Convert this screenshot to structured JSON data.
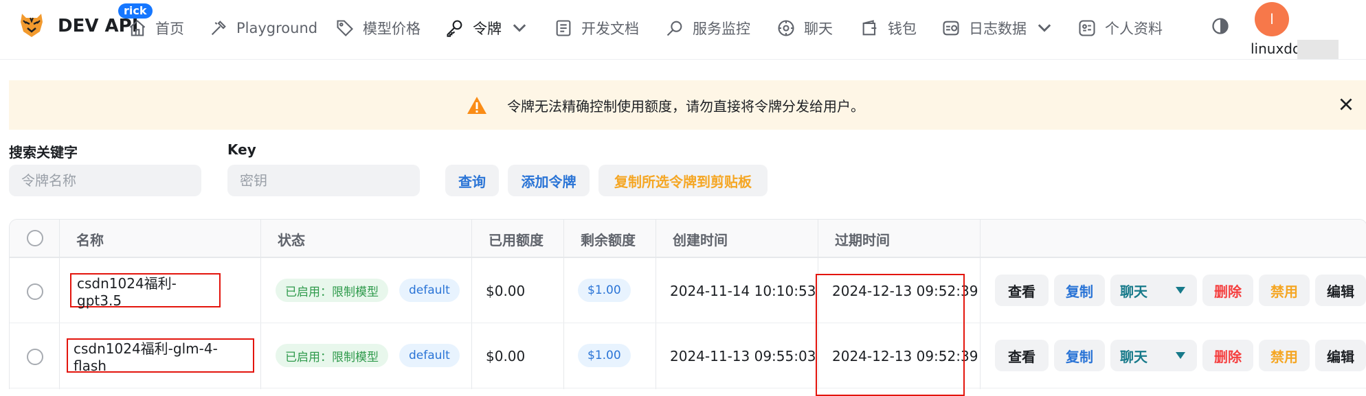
{
  "header": {
    "brand": "DEV API",
    "badge": "rick",
    "nav": [
      {
        "label": "首页",
        "icon": "home-icon"
      },
      {
        "label": "Playground",
        "icon": "playground-icon"
      },
      {
        "label": "模型价格",
        "icon": "tag-icon"
      },
      {
        "label": "令牌",
        "icon": "key-icon"
      },
      {
        "label": "开发文档",
        "icon": "document-icon"
      },
      {
        "label": "服务监控",
        "icon": "search-icon"
      },
      {
        "label": "聊天",
        "icon": "chat-icon"
      },
      {
        "label": "钱包",
        "icon": "wallet-icon"
      },
      {
        "label": "日志数据",
        "icon": "log-icon"
      },
      {
        "label": "个人资料",
        "icon": "profile-icon"
      }
    ],
    "avatar_letter": "l",
    "username": "linuxdo"
  },
  "banner": {
    "message": "令牌无法精确控制使用额度，请勿直接将令牌分发给用户。"
  },
  "search": {
    "keyword_label": "搜索关键字",
    "keyword_placeholder": "令牌名称",
    "key_label": "Key",
    "key_placeholder": "密钥",
    "query_button": "查询",
    "add_button": "添加令牌",
    "copy_button": "复制所选令牌到剪贴板"
  },
  "table": {
    "columns": [
      "名称",
      "状态",
      "已用额度",
      "剩余额度",
      "创建时间",
      "过期时间"
    ],
    "rows": [
      {
        "name": "csdn1024福利-gpt3.5",
        "status": "已启用：限制模型",
        "group": "default",
        "used": "$0.00",
        "remaining": "$1.00",
        "created": "2024-11-14 10:10:53",
        "expires": "2024-12-13 09:52:39"
      },
      {
        "name": "csdn1024福利-glm-4-flash",
        "status": "已启用：限制模型",
        "group": "default",
        "used": "$0.00",
        "remaining": "$1.00",
        "created": "2024-11-13 09:55:03",
        "expires": "2024-12-13 09:52:39"
      }
    ],
    "actions": {
      "view": "查看",
      "copy": "复制",
      "chat": "聊天",
      "delete": "删除",
      "disable": "禁用",
      "edit": "编辑"
    }
  },
  "colors": {
    "primary": "#1677ff",
    "link_blue": "#2a74d6",
    "warning_orange": "#f5a623",
    "danger_red": "#f53f3f",
    "teal": "#177a8a",
    "highlight_box": "#e3140c"
  }
}
